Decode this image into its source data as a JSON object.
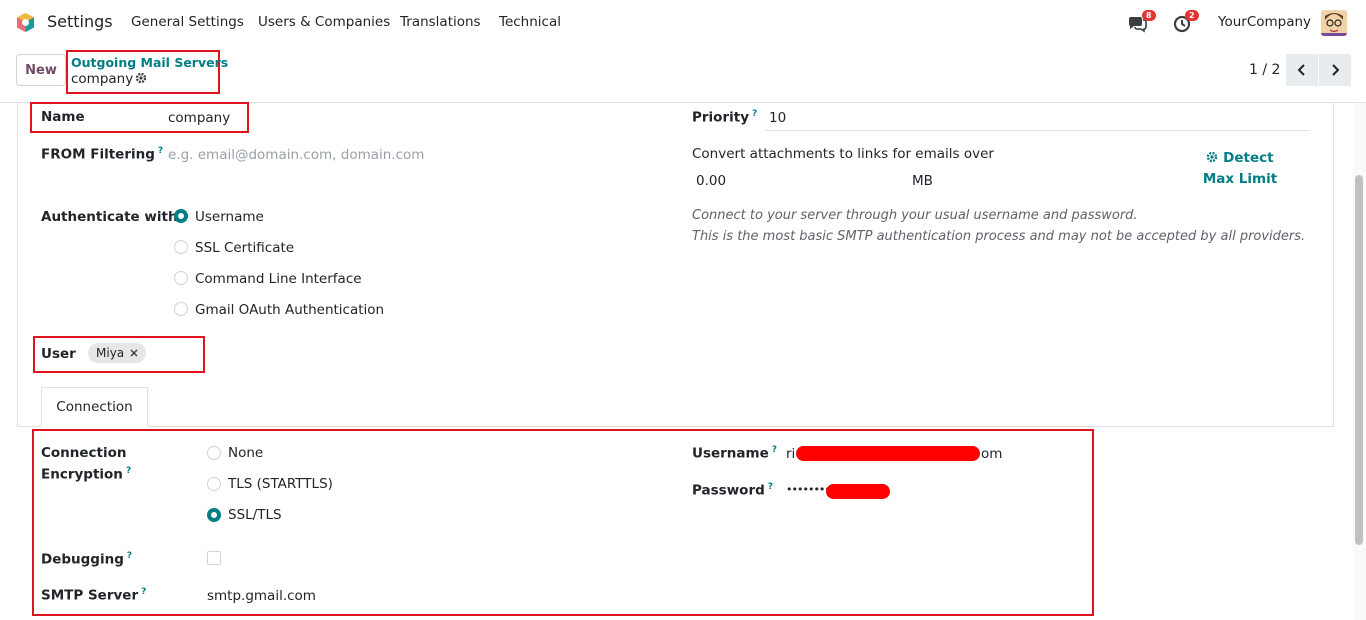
{
  "navbar": {
    "app_name": "Settings",
    "menu": [
      "General Settings",
      "Users & Companies",
      "Translations",
      "Technical"
    ],
    "messages_badge": "8",
    "activity_badge": "2",
    "company": "YourCompany",
    "icons": {
      "logo": "odoo-logo-icon",
      "messages": "chat-icon",
      "activity": "clock-icon",
      "avatar": "user-avatar"
    }
  },
  "control_panel": {
    "new_label": "New",
    "breadcrumb_parent": "Outgoing Mail Servers",
    "breadcrumb_current": "company",
    "pager": "1 / 2"
  },
  "form": {
    "name_label": "Name",
    "name_value": "company",
    "from_filtering_label": "FROM Filtering",
    "from_filtering_placeholder": "e.g. email@domain.com, domain.com",
    "priority_label": "Priority",
    "priority_value": "10",
    "convert_label": "Convert attachments to links for emails over",
    "convert_value": "0.00",
    "convert_unit": "MB",
    "detect_label": "Detect Max Limit",
    "auth_label": "Authenticate with",
    "auth_options": [
      "Username",
      "SSL Certificate",
      "Command Line Interface",
      "Gmail OAuth Authentication"
    ],
    "auth_selected": "Username",
    "auth_note_line1": "Connect to your server through your usual username and password.",
    "auth_note_line2": "This is the most basic SMTP authentication process and may not be accepted by all providers.",
    "user_label": "User",
    "user_tag": "Miya",
    "help_mark": "?"
  },
  "tabs": {
    "connection": "Connection"
  },
  "connection": {
    "encryption_label_line1": "Connection",
    "encryption_label_line2": "Encryption",
    "encryption_options": [
      "None",
      "TLS (STARTTLS)",
      "SSL/TLS"
    ],
    "encryption_selected": "SSL/TLS",
    "debugging_label": "Debugging",
    "smtp_label": "SMTP Server",
    "smtp_value": "smtp.gmail.com",
    "username_label": "Username",
    "username_prefix": "ri",
    "username_suffix": "om",
    "password_label": "Password",
    "password_value": "••••••••"
  },
  "colors": {
    "accent": "#017e84",
    "brand": "#714B67",
    "annotation": "#e0141e",
    "redaction": "#ff0000"
  }
}
